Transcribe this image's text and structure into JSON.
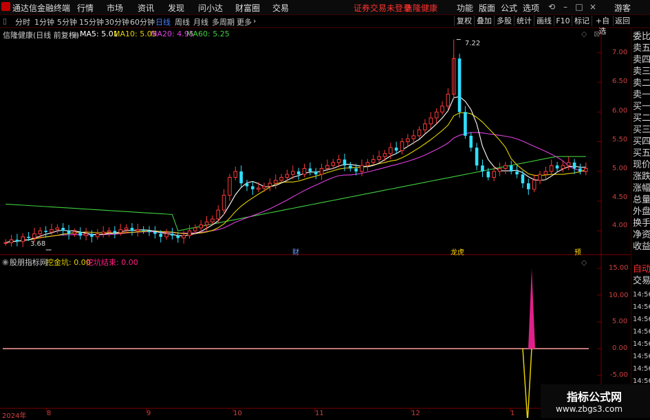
{
  "app": {
    "title": "通达信金融终端",
    "menu": [
      "行情",
      "市场",
      "资讯",
      "发现",
      "问小达",
      "财富圈",
      "交易"
    ],
    "notice": "证券交易未登录",
    "stock_name_red": "信隆健康",
    "right_menu": [
      "功能",
      "版面",
      "公式",
      "选项"
    ],
    "guest": "游客"
  },
  "periods": [
    "分时",
    "1分钟",
    "5分钟",
    "15分钟",
    "30分钟",
    "60分钟",
    "日线",
    "周线",
    "月线",
    "多周期",
    "更多"
  ],
  "active_period": "日线",
  "toolbar": [
    "复权",
    "叠加",
    "多股",
    "统计",
    "画线",
    "F10",
    "标记",
    "+自选",
    "返回"
  ],
  "main_chart": {
    "stock": "信隆健康(日线 前复权)",
    "ma": [
      {
        "label": "MA5: 5.01",
        "color": "#ffffff"
      },
      {
        "label": "MA10: 5.05",
        "color": "#e6d200"
      },
      {
        "label": "MA20: 4.95",
        "color": "#e040e0"
      },
      {
        "label": "MA60: 5.25",
        "color": "#40d040"
      }
    ],
    "y_ticks": [
      "7.00",
      "6.50",
      "6.00",
      "5.50",
      "5.00",
      "4.50",
      "4.00"
    ],
    "high_label": "7.22",
    "low_label": "3.68",
    "markers": [
      "财",
      "龙虎",
      "预"
    ]
  },
  "indicator": {
    "name": "股朋指标网",
    "line1": "挖金坑: 0.00",
    "line2": "挖坑结束: 0.00",
    "y_ticks": [
      "15.00",
      "10.00",
      "5.00",
      "0.00",
      "-5.00"
    ]
  },
  "x_labels": [
    "2024年",
    "8",
    "9",
    "10",
    "11",
    "12",
    "1"
  ],
  "side_panel": {
    "labels": [
      "委比",
      "卖五",
      "卖四",
      "卖三",
      "卖二",
      "卖一",
      "买一",
      "买二",
      "买三",
      "买四",
      "买五",
      "现价",
      "涨跌",
      "涨幅",
      "总量",
      "外盘",
      "换手",
      "净资",
      "收益"
    ],
    "bottom_labels": [
      "自动",
      "交易"
    ],
    "times": [
      "14:56",
      "14:56",
      "14:56",
      "14:56",
      "14:56",
      "14:56",
      "14:56",
      "14:56"
    ]
  },
  "watermark": {
    "title": "指标公式网",
    "url": "www.zbgs3.com"
  },
  "chart_data": {
    "type": "candlestick",
    "title": "信隆健康(日线 前复权)",
    "ylim": [
      3.6,
      7.4
    ],
    "series": [
      {
        "name": "MA5",
        "last": 5.01
      },
      {
        "name": "MA10",
        "last": 5.05
      },
      {
        "name": "MA20",
        "last": 4.95
      },
      {
        "name": "MA60",
        "last": 5.25
      }
    ],
    "close": [
      3.8,
      3.85,
      3.82,
      3.9,
      3.88,
      3.95,
      4.0,
      3.98,
      4.02,
      4.05,
      4.0,
      3.95,
      3.98,
      3.92,
      3.95,
      3.9,
      3.95,
      3.98,
      4.0,
      3.97,
      4.02,
      4.05,
      4.0,
      4.02,
      4.0,
      3.98,
      3.95,
      3.9,
      3.95,
      3.92,
      3.88,
      3.92,
      4.0,
      4.05,
      4.1,
      4.15,
      4.2,
      4.35,
      4.6,
      4.9,
      5.0,
      4.8,
      4.75,
      4.7,
      4.72,
      4.75,
      4.8,
      4.85,
      4.9,
      4.95,
      5.0,
      4.95,
      5.05,
      5.0,
      4.95,
      5.05,
      5.1,
      5.15,
      5.2,
      5.1,
      5.05,
      5.0,
      5.1,
      5.15,
      5.2,
      5.25,
      5.3,
      5.4,
      5.35,
      5.5,
      5.55,
      5.6,
      5.7,
      5.8,
      5.9,
      6.0,
      6.1,
      6.3,
      6.9,
      6.0,
      5.6,
      5.4,
      5.1,
      5.0,
      4.9,
      5.0,
      5.05,
      5.1,
      5.0,
      4.95,
      4.8,
      4.7,
      4.85,
      4.95,
      5.0,
      5.1,
      5.05,
      5.1,
      5.15,
      5.05,
      5.0,
      5.05
    ],
    "indicator_values": {
      "挖金坑": 0.0,
      "挖坑结束": 0.0,
      "spike_up": 15.0,
      "spike_down": -10.0
    }
  }
}
